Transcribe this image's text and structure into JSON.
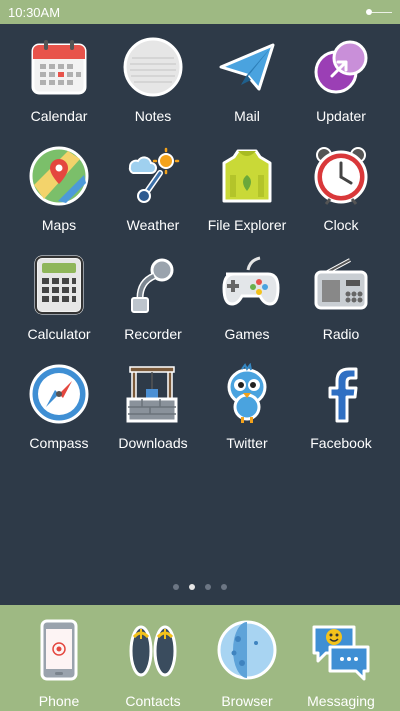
{
  "status_bar": {
    "time": "10:30AM"
  },
  "colors": {
    "background": "#2e3a48",
    "bar": "#9eb983"
  },
  "apps": [
    {
      "label": "Calendar",
      "icon": "calendar-icon"
    },
    {
      "label": "Notes",
      "icon": "notes-icon"
    },
    {
      "label": "Mail",
      "icon": "mail-icon"
    },
    {
      "label": "Updater",
      "icon": "updater-icon"
    },
    {
      "label": "Maps",
      "icon": "maps-icon"
    },
    {
      "label": "Weather",
      "icon": "weather-icon"
    },
    {
      "label": "File Explorer",
      "icon": "file-explorer-icon"
    },
    {
      "label": "Clock",
      "icon": "clock-icon"
    },
    {
      "label": "Calculator",
      "icon": "calculator-icon"
    },
    {
      "label": "Recorder",
      "icon": "recorder-icon"
    },
    {
      "label": "Games",
      "icon": "gamepad-icon"
    },
    {
      "label": "Radio",
      "icon": "radio-icon"
    },
    {
      "label": "Compass",
      "icon": "compass-icon"
    },
    {
      "label": "Downloads",
      "icon": "downloads-icon"
    },
    {
      "label": "Twitter",
      "icon": "twitter-bird-icon"
    },
    {
      "label": "Facebook",
      "icon": "facebook-icon"
    }
  ],
  "pager": {
    "pages": 4,
    "active_page": 2
  },
  "dock": [
    {
      "label": "Phone",
      "icon": "phone-icon"
    },
    {
      "label": "Contacts",
      "icon": "contacts-icon"
    },
    {
      "label": "Browser",
      "icon": "browser-icon"
    },
    {
      "label": "Messaging",
      "icon": "messaging-icon"
    }
  ]
}
